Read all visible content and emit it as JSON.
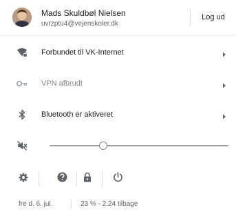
{
  "user": {
    "name": "Mads Skuldbøl Nielsen",
    "email": "uvrzptu4@vejenskoler.dk",
    "logout_label": "Log ud"
  },
  "network_rows": [
    {
      "label": "Forbundet til VK-Internet",
      "icon": "wifi-locked-icon",
      "enabled": true
    },
    {
      "label": "VPN afbrudt",
      "icon": "vpn-key-icon",
      "enabled": false
    },
    {
      "label": "Bluetooth er aktiveret",
      "icon": "bluetooth-icon",
      "enabled": true
    }
  ],
  "volume": {
    "icon": "volume-muted-icon",
    "level": 0.3
  },
  "system_buttons": [
    {
      "name": "settings",
      "icon": "gear-icon"
    },
    {
      "name": "help",
      "icon": "help-icon"
    },
    {
      "name": "lock",
      "icon": "lock-icon"
    },
    {
      "name": "power",
      "icon": "power-icon"
    }
  ],
  "footer": {
    "date": "fre d. 6. jul.",
    "battery": "23 % - 2.24 tilbage"
  },
  "colors": {
    "icon": "#5f6368",
    "icon_disabled": "#9aa0a6",
    "divider": "#e8eaed"
  }
}
